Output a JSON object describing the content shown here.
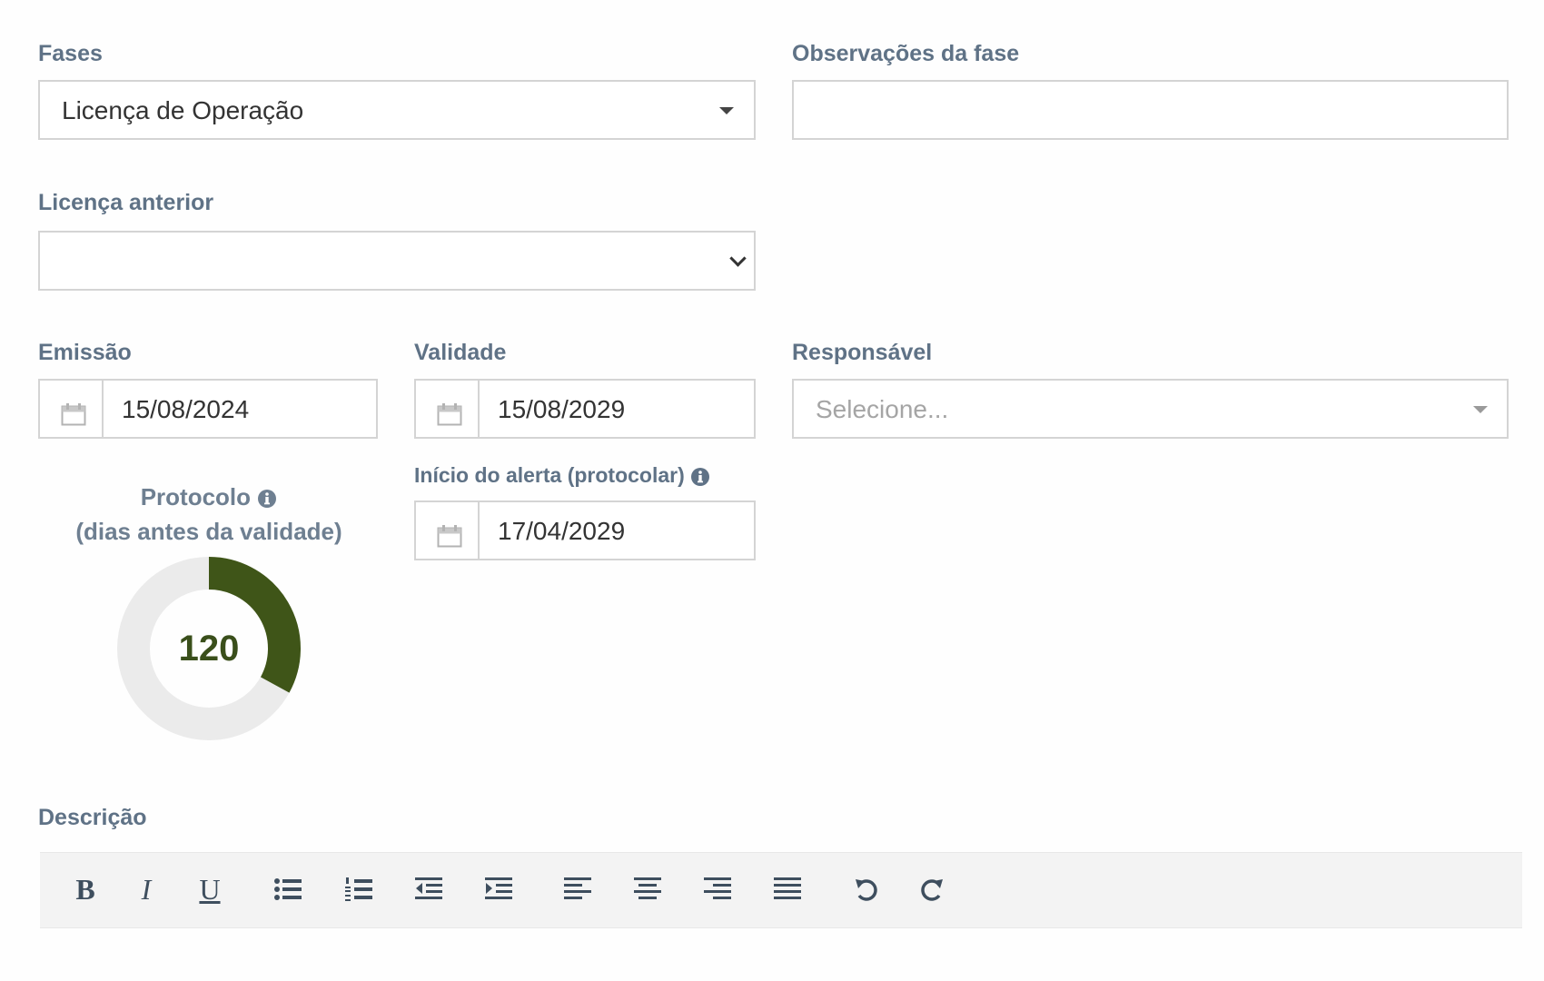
{
  "fases": {
    "label": "Fases",
    "value": "Licença de Operação"
  },
  "observacoes": {
    "label": "Observações da fase",
    "value": ""
  },
  "licenca_anterior": {
    "label": "Licença anterior",
    "value": ""
  },
  "emissao": {
    "label": "Emissão",
    "value": "15/08/2024"
  },
  "validade": {
    "label": "Validade",
    "value": "15/08/2029"
  },
  "responsavel": {
    "label": "Responsável",
    "placeholder": "Selecione..."
  },
  "inicio_alerta": {
    "label": "Início do alerta (protocolar)",
    "value": "17/04/2029"
  },
  "protocolo": {
    "title": "Protocolo",
    "subtitle": "(dias antes da validade)",
    "value": "120",
    "fill_fraction": 0.33,
    "fill_color": "#3f5518",
    "track_color": "#ebebeb"
  },
  "descricao": {
    "label": "Descrição"
  },
  "toolbar": {
    "bold": "B",
    "italic": "I",
    "underline": "U",
    "buttons": [
      "bold",
      "italic",
      "underline",
      "unordered-list",
      "ordered-list",
      "outdent",
      "indent",
      "align-left",
      "align-center",
      "align-right",
      "align-justify",
      "undo",
      "redo"
    ]
  }
}
